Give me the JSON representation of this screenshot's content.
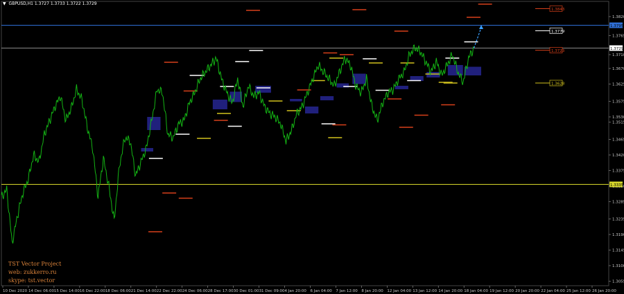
{
  "symbol_bar": {
    "arrow": "▼",
    "symbol": "GBPUSD,H1",
    "prices": "1.3727 1.3733 1.3722 1.3729"
  },
  "branding": {
    "line1": "TST Vector Project",
    "line2": "web: zukkerro.ru",
    "line3": "skype: tst.vector"
  },
  "colors": {
    "background": "#000000",
    "price_line": "#14b414",
    "blue_line": "#2f6fd6",
    "yellow_line": "#d6d62a",
    "grey_line": "#8a8a8a",
    "red_level": "#d8401a",
    "white_level": "#ffffff",
    "yellow_level": "#d2c21e",
    "zone": "#23238a",
    "forecast": "#3aa0ff"
  },
  "chart_data": {
    "type": "line",
    "title": "",
    "symbol": "GBPUSD,H1",
    "ylim": [
      1.3042,
      1.3864
    ],
    "y_ticks": [
      "1.3820",
      "1.3765",
      "1.3710",
      "1.3670",
      "1.3625",
      "1.3575",
      "1.3530",
      "1.3515",
      "1.3465",
      "1.3420",
      "1.3375",
      "1.3330",
      "1.3285",
      "1.3235",
      "1.3190",
      "1.3145",
      "1.3100",
      "1.3055"
    ],
    "x_ticks": [
      "10 Dec 2020",
      "14 Dec 06:00",
      "15 Dec 14:00",
      "16 Dec 22:00",
      "18 Dec 06:00",
      "21 Dec 14:00",
      "22 Dec 22:00",
      "24 Dec 06:00",
      "28 Dec 17:00",
      "30 Dec 01:00",
      "31 Dec 09:00",
      "4 Jan 20:00",
      "6 Jan 04:00",
      "7 Jan 12:00",
      "8 Jan 20:00",
      "12 Jan 04:00",
      "13 Jan 12:00",
      "14 Jan 20:00",
      "18 Jan 04:00",
      "19 Jan 12:00",
      "20 Jan 20:00",
      "22 Jan 04:00",
      "25 Jan 12:00",
      "26 Jan 20:00"
    ],
    "price_series": {
      "name": "",
      "values": [
        1.3298,
        1.332,
        1.3165,
        1.3245,
        1.331,
        1.335,
        1.342,
        1.34,
        1.348,
        1.352,
        1.356,
        1.359,
        1.352,
        1.3555,
        1.361,
        1.358,
        1.35,
        1.344,
        1.33,
        1.341,
        1.333,
        1.323,
        1.339,
        1.347,
        1.346,
        1.336,
        1.34,
        1.344,
        1.352,
        1.361,
        1.36,
        1.348,
        1.347,
        1.351,
        1.352,
        1.357,
        1.36,
        1.364,
        1.366,
        1.368,
        1.37,
        1.364,
        1.36,
        1.357,
        1.364,
        1.356,
        1.362,
        1.359,
        1.36,
        1.356,
        1.354,
        1.353,
        1.351,
        1.346,
        1.349,
        1.354,
        1.356,
        1.36,
        1.364,
        1.368,
        1.366,
        1.364,
        1.362,
        1.366,
        1.37,
        1.368,
        1.362,
        1.36,
        1.364,
        1.356,
        1.352,
        1.357,
        1.36,
        1.361,
        1.364,
        1.366,
        1.371,
        1.373,
        1.372,
        1.369,
        1.366,
        1.369,
        1.365,
        1.368,
        1.371,
        1.366,
        1.363,
        1.37,
        1.3729
      ]
    },
    "current_price_label": "1.3729",
    "horizontal_lines": [
      {
        "label": "1.3795",
        "value": 1.3795,
        "color": "blue"
      },
      {
        "label": "1.3729",
        "value": 1.3729,
        "color": "grey"
      },
      {
        "label": "1.3335",
        "value": 1.3335,
        "color": "yellow"
      }
    ],
    "level_tags": [
      {
        "label": "1.3843",
        "value": 1.3843,
        "color": "red"
      },
      {
        "label": "1.3779",
        "value": 1.3779,
        "color": "white"
      },
      {
        "label": "1.3723",
        "value": 1.3723,
        "color": "red"
      },
      {
        "label": "1.3628",
        "value": 1.3628,
        "color": "yellow"
      }
    ],
    "forecast": {
      "from": 1.3729,
      "to": 1.3788
    },
    "red_levels": [
      {
        "x": 0.403,
        "v": 1.3838
      },
      {
        "x": 0.578,
        "v": 1.384
      },
      {
        "x": 0.268,
        "v": 1.3688
      },
      {
        "x": 0.53,
        "v": 1.3715
      },
      {
        "x": 0.647,
        "v": 1.3778
      },
      {
        "x": 0.3,
        "v": 1.3605
      },
      {
        "x": 0.487,
        "v": 1.3608
      },
      {
        "x": 0.557,
        "v": 1.371
      },
      {
        "x": 0.636,
        "v": 1.3582
      },
      {
        "x": 0.724,
        "v": 1.3565
      },
      {
        "x": 0.68,
        "v": 1.3535
      },
      {
        "x": 0.35,
        "v": 1.352
      },
      {
        "x": 0.545,
        "v": 1.3507
      },
      {
        "x": 0.655,
        "v": 1.35
      },
      {
        "x": 0.265,
        "v": 1.331
      },
      {
        "x": 0.292,
        "v": 1.3295
      },
      {
        "x": 0.242,
        "v": 1.3198
      },
      {
        "x": 0.785,
        "v": 1.3856
      },
      {
        "x": 0.766,
        "v": 1.3818
      }
    ],
    "white_levels": [
      {
        "x": 0.408,
        "v": 1.3722
      },
      {
        "x": 0.385,
        "v": 1.369
      },
      {
        "x": 0.31,
        "v": 1.365
      },
      {
        "x": 0.36,
        "v": 1.3618
      },
      {
        "x": 0.42,
        "v": 1.3614
      },
      {
        "x": 0.563,
        "v": 1.3618
      },
      {
        "x": 0.595,
        "v": 1.3698
      },
      {
        "x": 0.616,
        "v": 1.3607
      },
      {
        "x": 0.668,
        "v": 1.3635
      },
      {
        "x": 0.731,
        "v": 1.37
      },
      {
        "x": 0.762,
        "v": 1.3747
      },
      {
        "x": 0.373,
        "v": 1.3503
      },
      {
        "x": 0.527,
        "v": 1.351
      },
      {
        "x": 0.287,
        "v": 1.348
      },
      {
        "x": 0.243,
        "v": 1.341
      }
    ],
    "yellow_levels": [
      {
        "x": 0.54,
        "v": 1.37
      },
      {
        "x": 0.605,
        "v": 1.3686
      },
      {
        "x": 0.657,
        "v": 1.3686
      },
      {
        "x": 0.698,
        "v": 1.3654
      },
      {
        "x": 0.44,
        "v": 1.3576
      },
      {
        "x": 0.355,
        "v": 1.354
      },
      {
        "x": 0.51,
        "v": 1.3635
      },
      {
        "x": 0.728,
        "v": 1.3628
      },
      {
        "x": 0.538,
        "v": 1.347
      },
      {
        "x": 0.322,
        "v": 1.3468
      },
      {
        "x": 0.47,
        "v": 1.3548
      },
      {
        "x": 0.72,
        "v": 1.363
      }
    ],
    "zones": [
      {
        "x0": 0.24,
        "x1": 0.262,
        "hi": 1.353,
        "lo": 1.3492
      },
      {
        "x0": 0.23,
        "x1": 0.25,
        "hi": 1.344,
        "lo": 1.343
      },
      {
        "x0": 0.348,
        "x1": 0.372,
        "hi": 1.358,
        "lo": 1.3552
      },
      {
        "x0": 0.376,
        "x1": 0.396,
        "hi": 1.3603,
        "lo": 1.3573
      },
      {
        "x0": 0.418,
        "x1": 0.444,
        "hi": 1.362,
        "lo": 1.36
      },
      {
        "x0": 0.475,
        "x1": 0.495,
        "hi": 1.3582,
        "lo": 1.3575
      },
      {
        "x0": 0.5,
        "x1": 0.522,
        "hi": 1.356,
        "lo": 1.354
      },
      {
        "x0": 0.525,
        "x1": 0.547,
        "hi": 1.359,
        "lo": 1.3578
      },
      {
        "x0": 0.552,
        "x1": 0.572,
        "hi": 1.3627,
        "lo": 1.3615
      },
      {
        "x0": 0.578,
        "x1": 0.6,
        "hi": 1.3655,
        "lo": 1.3625
      },
      {
        "x0": 0.648,
        "x1": 0.67,
        "hi": 1.362,
        "lo": 1.361
      },
      {
        "x0": 0.673,
        "x1": 0.695,
        "hi": 1.3648,
        "lo": 1.3634
      },
      {
        "x0": 0.7,
        "x1": 0.722,
        "hi": 1.366,
        "lo": 1.3644
      },
      {
        "x0": 0.735,
        "x1": 0.76,
        "hi": 1.368,
        "lo": 1.365
      },
      {
        "x0": 0.762,
        "x1": 0.79,
        "hi": 1.3675,
        "lo": 1.365
      }
    ]
  }
}
